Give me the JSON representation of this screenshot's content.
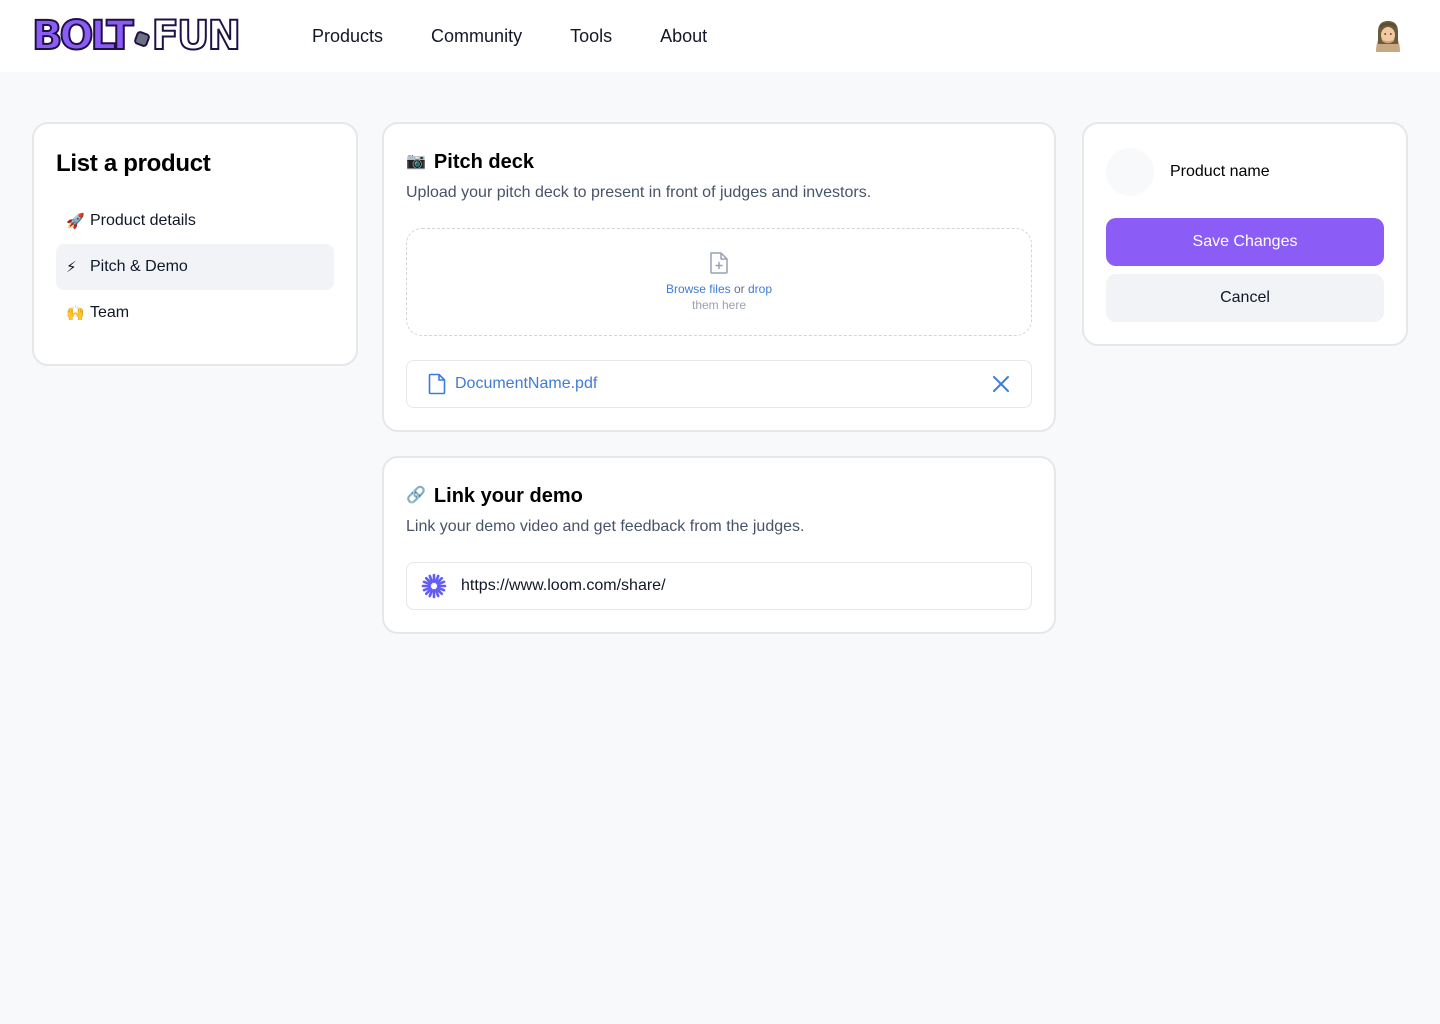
{
  "nav": {
    "logo_left": "BOLT",
    "logo_right": "FUN",
    "links": [
      "Products",
      "Community",
      "Tools",
      "About"
    ]
  },
  "sidebar": {
    "title": "List a product",
    "items": [
      {
        "emoji": "🚀",
        "label": "Product details",
        "icon": "rocket-icon",
        "active": false
      },
      {
        "emoji": "⚡",
        "label": "Pitch & Demo",
        "icon": "lightning-icon",
        "active": true
      },
      {
        "emoji": "🙌",
        "label": "Team",
        "icon": "raised-hands-icon",
        "active": false
      }
    ]
  },
  "pitch": {
    "emoji": "📷",
    "title": "Pitch deck",
    "description": "Upload your pitch deck to present in front of judges and investors.",
    "dropzone": {
      "browse_label": "Browse files",
      "or_label": "or",
      "drop_label": "drop",
      "hint": "them here"
    },
    "file": {
      "name": "DocumentName.pdf"
    }
  },
  "demo": {
    "emoji": "🔗",
    "title": "Link your demo",
    "description": "Link your demo video and get feedback from the judges.",
    "url_value": "https://www.loom.com/share/"
  },
  "summary": {
    "product_name": "Product name",
    "save_label": "Save Changes",
    "cancel_label": "Cancel"
  },
  "colors": {
    "accent": "#8B5CF6",
    "link": "#3E7BDB",
    "loom": "#625DF5",
    "background": "#F8F9FB"
  }
}
